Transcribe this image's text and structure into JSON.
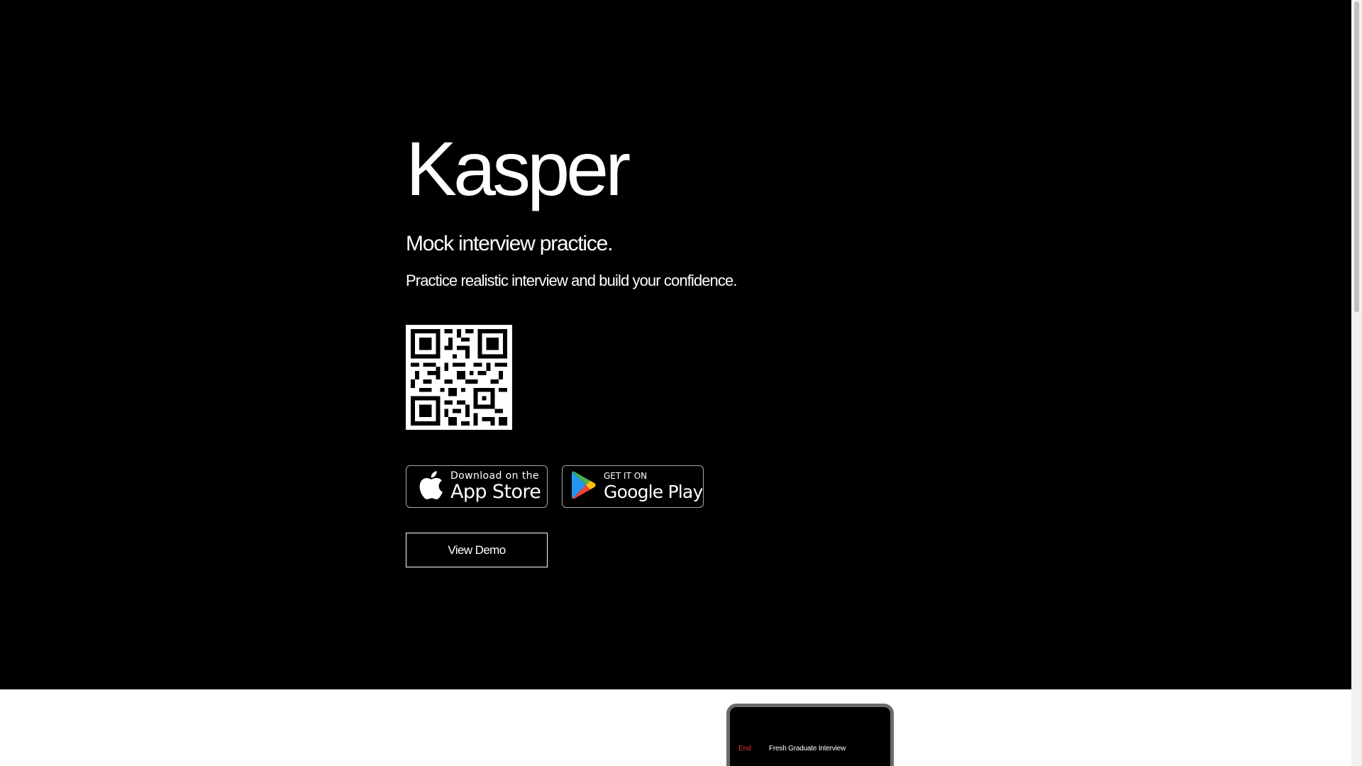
{
  "hero": {
    "title": "Kasper",
    "headline": "Mock interview practice.",
    "subtitle": "Practice realistic interview and build your confidence."
  },
  "badges": {
    "appstore": {
      "small": "Download on the",
      "big": "App Store"
    },
    "google": {
      "small": "GET IT ON",
      "big": "Google Play"
    }
  },
  "demo_button": "View Demo",
  "phone_preview": {
    "end_label": "End",
    "title": "Fresh Graduate Interview"
  },
  "colors": {
    "hero_background": "#000000",
    "section_background": "#ffffff",
    "end_label": "#e53935"
  }
}
